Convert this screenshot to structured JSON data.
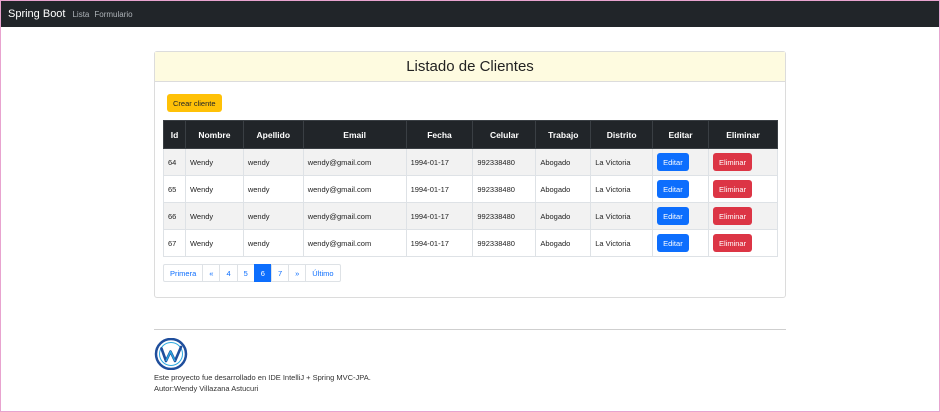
{
  "navbar": {
    "brand": "Spring Boot",
    "links": [
      "Lista",
      "Formulario"
    ]
  },
  "card": {
    "title": "Listado de Clientes",
    "create_button": "Crear cliente"
  },
  "table": {
    "headers": [
      "Id",
      "Nombre",
      "Apellido",
      "Email",
      "Fecha",
      "Celular",
      "Trabajo",
      "Distrito",
      "Editar",
      "Eliminar"
    ],
    "rows": [
      {
        "id": "64",
        "nombre": "Wendy",
        "apellido": "wendy",
        "email": "wendy@gmail.com",
        "fecha": "1994-01-17",
        "celular": "992338480",
        "trabajo": "Abogado",
        "distrito": "La Victoria"
      },
      {
        "id": "65",
        "nombre": "Wendy",
        "apellido": "wendy",
        "email": "wendy@gmail.com",
        "fecha": "1994-01-17",
        "celular": "992338480",
        "trabajo": "Abogado",
        "distrito": "La Victoria"
      },
      {
        "id": "66",
        "nombre": "Wendy",
        "apellido": "wendy",
        "email": "wendy@gmail.com",
        "fecha": "1994-01-17",
        "celular": "992338480",
        "trabajo": "Abogado",
        "distrito": "La Victoria"
      },
      {
        "id": "67",
        "nombre": "Wendy",
        "apellido": "wendy",
        "email": "wendy@gmail.com",
        "fecha": "1994-01-17",
        "celular": "992338480",
        "trabajo": "Abogado",
        "distrito": "La Victoria"
      }
    ],
    "edit_label": "Editar",
    "delete_label": "Eliminar"
  },
  "pagination": {
    "items": [
      "Primera",
      "«",
      "4",
      "5",
      "6",
      "7",
      "»",
      "Último"
    ],
    "active": "6"
  },
  "footer": {
    "logo_icon": "w-logo-icon",
    "line1": "Este proyecto fue desarrollado en IDE IntelliJ + Spring MVC-JPA.",
    "line2": "Autor:Wendy Villazana Astucuri"
  },
  "colors": {
    "navbar": "#212529",
    "warning": "#ffc107",
    "primary": "#0d6efd",
    "danger": "#dc3545",
    "header_bg": "#fefbe0"
  }
}
